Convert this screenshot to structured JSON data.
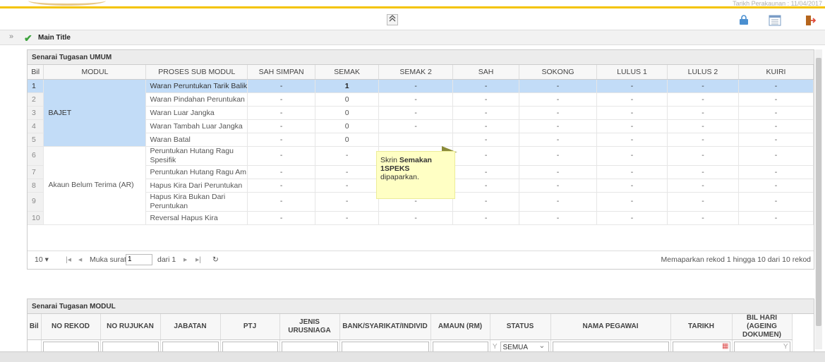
{
  "header": {
    "date_text": "Tarikh Perakaunan : 11/04/2017"
  },
  "toolbar": {
    "collapse_glyph": "»",
    "icons": [
      "lock-icon",
      "list-icon",
      "exit-icon"
    ]
  },
  "titlebar": {
    "expand_glyph": "»",
    "title": "Main Title"
  },
  "umum": {
    "heading": "Senarai Tugasan UMUM",
    "columns": [
      "Bil",
      "MODUL",
      "PROSES SUB MODUL",
      "SAH SIMPAN",
      "SEMAK",
      "SEMAK 2",
      "SAH",
      "SOKONG",
      "LULUS 1",
      "LULUS 2",
      "KUIRI"
    ],
    "modul_bajet": "BAJET",
    "modul_ar": "Akaun Belum Terima (AR)",
    "rows": [
      {
        "bil": "1",
        "proses": "Waran Peruntukan Tarik Balik",
        "vals": [
          "-",
          "1",
          "-",
          "-",
          "-",
          "-",
          "-",
          "-"
        ]
      },
      {
        "bil": "2",
        "proses": "Waran Pindahan Peruntukan",
        "vals": [
          "-",
          "0",
          "-",
          "-",
          "-",
          "-",
          "-",
          "-"
        ]
      },
      {
        "bil": "3",
        "proses": "Waran Luar Jangka",
        "vals": [
          "-",
          "0",
          "-",
          "-",
          "-",
          "-",
          "-",
          "-"
        ]
      },
      {
        "bil": "4",
        "proses": "Waran Tambah Luar Jangka",
        "vals": [
          "-",
          "0",
          "-",
          "-",
          "-",
          "-",
          "-",
          "-"
        ]
      },
      {
        "bil": "5",
        "proses": "Waran Batal",
        "vals": [
          "-",
          "0",
          "",
          "-",
          "-",
          "-",
          "-",
          "-"
        ]
      },
      {
        "bil": "6",
        "proses": "Peruntukan Hutang Ragu Spesifik",
        "vals": [
          "-",
          "-",
          "",
          "-",
          "-",
          "-",
          "-",
          "-"
        ]
      },
      {
        "bil": "7",
        "proses": "Peruntukan Hutang Ragu Am",
        "vals": [
          "-",
          "-",
          "",
          "-",
          "-",
          "-",
          "-",
          "-"
        ]
      },
      {
        "bil": "8",
        "proses": "Hapus Kira Dari Peruntukan",
        "vals": [
          "-",
          "-",
          "",
          "-",
          "-",
          "-",
          "-",
          "-"
        ]
      },
      {
        "bil": "9",
        "proses": "Hapus Kira Bukan Dari Peruntukan",
        "vals": [
          "-",
          "-",
          "-",
          "-",
          "-",
          "-",
          "-",
          "-"
        ]
      },
      {
        "bil": "10",
        "proses": "Reversal Hapus Kira",
        "vals": [
          "-",
          "-",
          "-",
          "-",
          "-",
          "-",
          "-",
          "-"
        ]
      }
    ],
    "pager": {
      "page_size": "10",
      "label_page": "Muka surat",
      "page": "1",
      "label_of": "dari 1",
      "summary": "Memaparkan rekod 1 hingga 10 dari 10 rekod"
    }
  },
  "tooltip": {
    "line1_a": "Skrin ",
    "line1_b": "Semakan",
    "line2": "1SPEKS",
    "line3": "dipaparkan."
  },
  "modul": {
    "heading": "Senarai Tugasan MODUL",
    "columns": [
      "Bil",
      "NO REKOD",
      "NO RUJUKAN",
      "JABATAN",
      "PTJ",
      "JENIS URUSNIAGA",
      "BANK/SYARIKAT/INDIVID",
      "AMAUN (RM)",
      "STATUS",
      "NAMA PEGAWAI",
      "TARIKH",
      "BIL HARI (AGEING DOKUMEN)"
    ],
    "status_value": "SEMUA"
  }
}
